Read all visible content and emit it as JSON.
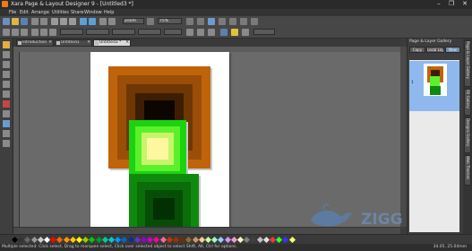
{
  "app": {
    "title": "Xara Page & Layout Designer 9 - [Untitled3 *]",
    "window_buttons": [
      "–",
      "❐",
      "✕"
    ]
  },
  "menu": [
    "File",
    "Edit",
    "Arrange",
    "Utilities",
    "Share",
    "Window",
    "Help"
  ],
  "toolbar1": {
    "zoom_value": "Zoom",
    "zoom_percent": "75%"
  },
  "toolbar2": {
    "x_value": "",
    "y_value": ""
  },
  "tabs": [
    {
      "label": "Introduction",
      "active": false
    },
    {
      "label": "Untitled1",
      "active": false
    },
    {
      "label": "Untitled3 *",
      "active": true
    }
  ],
  "panel": {
    "title": "Page & Layer Gallery",
    "buttons": [
      "Copy",
      "Local Lay",
      "New"
    ],
    "page_number": "1"
  },
  "side_tabs": [
    "Page & Layer Gallery",
    "Fill Gallery",
    "Designs Gallery",
    "Web Themes"
  ],
  "status": {
    "message": "Multiple selected: Click select, Drag to marquee select, Click over selected object to select Shift, Alt, Ctrl for options.",
    "coords": "34.05, 25.04mm"
  },
  "palette_colors": [
    "#000000",
    "#333333",
    "#666666",
    "#999999",
    "#cccccc",
    "#ffffff",
    "#ff0000",
    "#ff6600",
    "#ff9900",
    "#ffcc00",
    "#ffff00",
    "#99cc00",
    "#00cc00",
    "#009933",
    "#00cc99",
    "#00cccc",
    "#0099ff",
    "#0066cc",
    "#003399",
    "#6633cc",
    "#9900cc",
    "#cc00cc",
    "#ff0099",
    "#ff6699",
    "#cc3300",
    "#993300",
    "#663300",
    "#996633",
    "#cc9966",
    "#ffcc99",
    "#ccff99",
    "#99ffcc",
    "#99ccff",
    "#cc99ff",
    "#ff99cc",
    "#ffffcc",
    "#808080",
    "#404040",
    "#c0c0c0",
    "#e0e0e0",
    "#ff3333",
    "#33ff33",
    "#3333ff",
    "#ffff66"
  ],
  "watermark_text": "ZIGG"
}
